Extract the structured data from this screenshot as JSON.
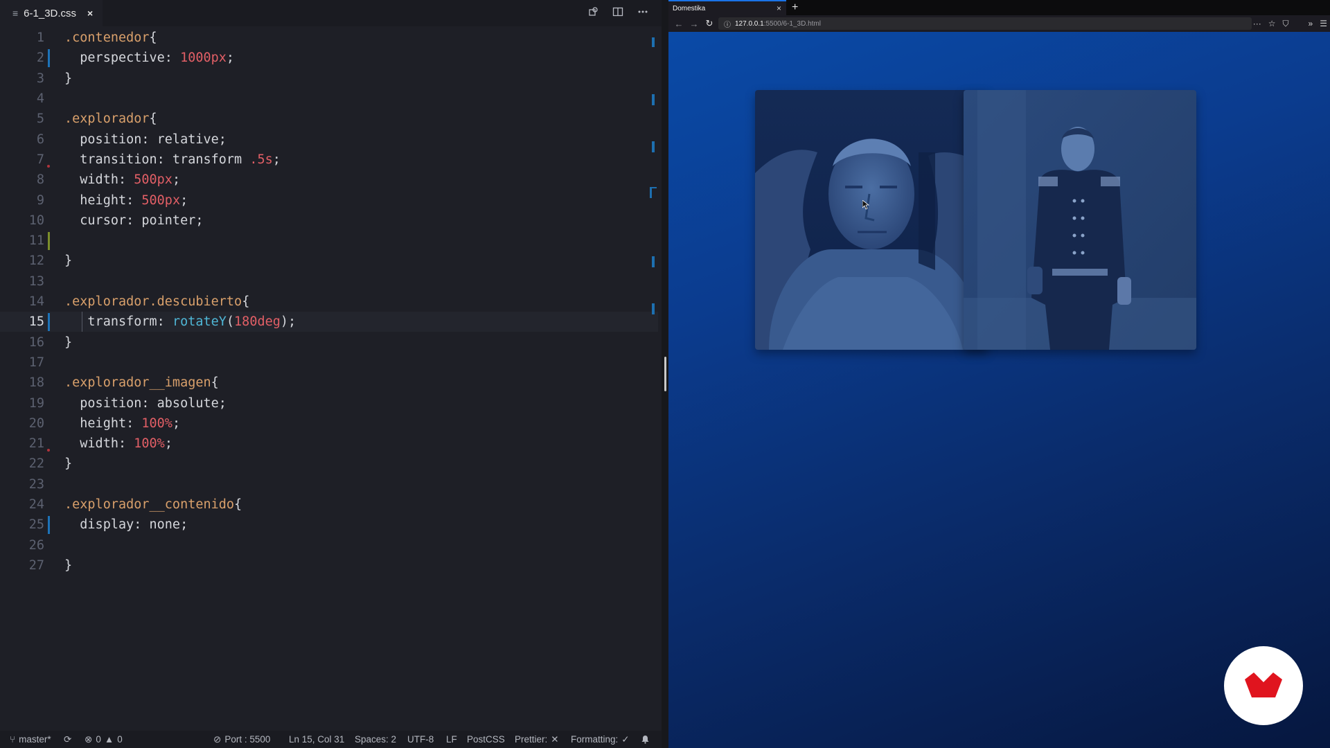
{
  "editor": {
    "tab": {
      "icon": "≡",
      "filename": "6-1_3D.css",
      "close": "×"
    },
    "actions": [
      "compare-icon",
      "split-editor-icon",
      "more-icon"
    ],
    "lines": [
      {
        "n": "1",
        "segments": [
          {
            "t": ".contenedor",
            "c": "sel"
          },
          {
            "t": "{",
            "c": "punc"
          }
        ]
      },
      {
        "n": "2",
        "segments": [
          {
            "t": "  perspective: ",
            "c": "prop"
          },
          {
            "t": "1000px",
            "c": "num"
          },
          {
            "t": ";",
            "c": "punc"
          }
        ]
      },
      {
        "n": "3",
        "segments": [
          {
            "t": "}",
            "c": "punc"
          }
        ]
      },
      {
        "n": "4",
        "segments": []
      },
      {
        "n": "5",
        "segments": [
          {
            "t": ".explorador",
            "c": "sel"
          },
          {
            "t": "{",
            "c": "punc"
          }
        ]
      },
      {
        "n": "6",
        "segments": [
          {
            "t": "  position: relative;",
            "c": "prop"
          }
        ]
      },
      {
        "n": "7",
        "segments": [
          {
            "t": "  transition: transform ",
            "c": "prop"
          },
          {
            "t": ".5s",
            "c": "num"
          },
          {
            "t": ";",
            "c": "punc"
          }
        ]
      },
      {
        "n": "8",
        "segments": [
          {
            "t": "  width: ",
            "c": "prop"
          },
          {
            "t": "500px",
            "c": "num"
          },
          {
            "t": ";",
            "c": "punc"
          }
        ]
      },
      {
        "n": "9",
        "segments": [
          {
            "t": "  height: ",
            "c": "prop"
          },
          {
            "t": "500px",
            "c": "num"
          },
          {
            "t": ";",
            "c": "punc"
          }
        ]
      },
      {
        "n": "10",
        "segments": [
          {
            "t": "  cursor: pointer;",
            "c": "prop"
          }
        ]
      },
      {
        "n": "11",
        "segments": []
      },
      {
        "n": "12",
        "segments": [
          {
            "t": "}",
            "c": "punc"
          }
        ]
      },
      {
        "n": "13",
        "segments": []
      },
      {
        "n": "14",
        "segments": [
          {
            "t": ".explorador.descubierto",
            "c": "sel"
          },
          {
            "t": "{",
            "c": "punc"
          }
        ]
      },
      {
        "n": "15",
        "segments": [
          {
            "t": "   transform: ",
            "c": "prop"
          },
          {
            "t": "rotateY",
            "c": "fn"
          },
          {
            "t": "(",
            "c": "punc"
          },
          {
            "t": "180deg",
            "c": "num"
          },
          {
            "t": ");",
            "c": "punc"
          }
        ]
      },
      {
        "n": "16",
        "segments": [
          {
            "t": "}",
            "c": "punc"
          }
        ]
      },
      {
        "n": "17",
        "segments": []
      },
      {
        "n": "18",
        "segments": [
          {
            "t": ".explorador__imagen",
            "c": "sel"
          },
          {
            "t": "{",
            "c": "punc"
          }
        ]
      },
      {
        "n": "19",
        "segments": [
          {
            "t": "  position: absolute;",
            "c": "prop"
          }
        ]
      },
      {
        "n": "20",
        "segments": [
          {
            "t": "  height: ",
            "c": "prop"
          },
          {
            "t": "100%",
            "c": "num"
          },
          {
            "t": ";",
            "c": "punc"
          }
        ]
      },
      {
        "n": "21",
        "segments": [
          {
            "t": "  width: ",
            "c": "prop"
          },
          {
            "t": "100%",
            "c": "num"
          },
          {
            "t": ";",
            "c": "punc"
          }
        ]
      },
      {
        "n": "22",
        "segments": [
          {
            "t": "}",
            "c": "punc"
          }
        ]
      },
      {
        "n": "23",
        "segments": []
      },
      {
        "n": "24",
        "segments": [
          {
            "t": ".explorador__contenido",
            "c": "sel"
          },
          {
            "t": "{",
            "c": "punc"
          }
        ]
      },
      {
        "n": "25",
        "segments": [
          {
            "t": "  display: none;",
            "c": "prop"
          }
        ]
      },
      {
        "n": "26",
        "segments": []
      },
      {
        "n": "27",
        "segments": [
          {
            "t": "}",
            "c": "punc"
          }
        ]
      }
    ],
    "current_line": "15"
  },
  "status_bar": {
    "branch": "master*",
    "errors": "0",
    "warnings": "0",
    "port": "Port : 5500",
    "position": "Ln 15, Col 31",
    "spaces": "Spaces: 2",
    "encoding": "UTF-8",
    "eol": "LF",
    "language": "PostCSS",
    "prettier": "Prettier:",
    "formatting": "Formatting:"
  },
  "browser": {
    "tab_title": "Domestika",
    "tab_close": "×",
    "new_tab": "+",
    "url_host": "127.0.0.1",
    "url_path": ":5500/6-1_3D.html",
    "colors": {
      "accent": "#1a73e8",
      "brand": "#e0141e"
    }
  },
  "page": {
    "cards": [
      {
        "name": "explorer-card-fur-hood",
        "subject": "portrait-fur-hood"
      },
      {
        "name": "explorer-card-uniform",
        "subject": "portrait-uniform"
      }
    ],
    "badge_icon": "domestika-logo"
  }
}
